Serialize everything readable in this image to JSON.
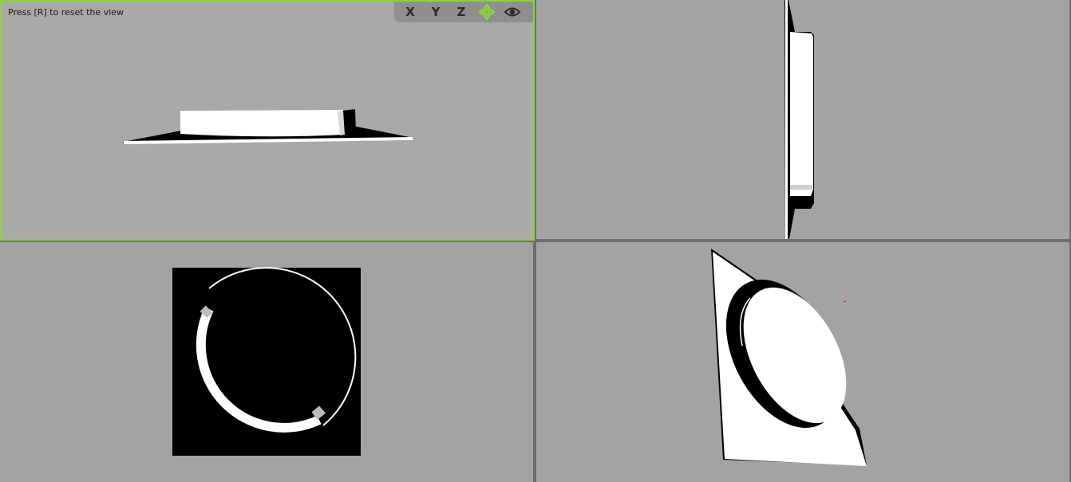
{
  "viewport_top_left": {
    "hint": "Press [R] to reset the view"
  },
  "toolbar": {
    "x_label": "X",
    "y_label": "Y",
    "z_label": "Z",
    "active_icon": "move-view-icon",
    "eye_icon": "eye-icon",
    "accent": "#8cd43a"
  },
  "colors": {
    "active_border": "#8cd43a",
    "viewport_bg": "#a3a3a3",
    "active_viewport_bg": "#a9a9a9",
    "divider": "#6e6e6e"
  }
}
